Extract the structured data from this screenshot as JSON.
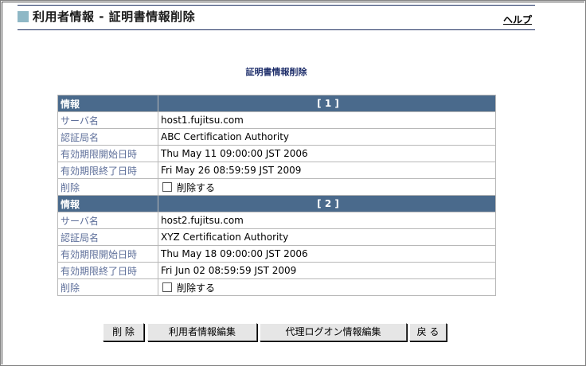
{
  "header": {
    "title": "利用者情報 - 証明書情報削除",
    "help_label": "ヘルプ"
  },
  "section_title": "証明書情報削除",
  "certificates": [
    {
      "head_label": "情報",
      "head_number": "[ 1 ]",
      "server_label": "サーバ名",
      "server_value": "host1.fujitsu.com",
      "ca_label": "認証局名",
      "ca_value": "ABC Certification Authority",
      "start_label": "有効期限開始日時",
      "start_value": "Thu May 11 09:00:00 JST 2006",
      "end_label": "有効期限終了日時",
      "end_value": "Fri May 26 08:59:59 JST 2009",
      "delete_label": "削除",
      "delete_checkbox_label": "削除する",
      "delete_checked": false
    },
    {
      "head_label": "情報",
      "head_number": "[ 2 ]",
      "server_label": "サーバ名",
      "server_value": "host2.fujitsu.com",
      "ca_label": "認証局名",
      "ca_value": "XYZ Certification Authority",
      "start_label": "有効期限開始日時",
      "start_value": "Thu May 18 09:00:00 JST 2006",
      "end_label": "有効期限終了日時",
      "end_value": "Fri Jun 02 08:59:59 JST 2009",
      "delete_label": "削除",
      "delete_checkbox_label": "削除する",
      "delete_checked": false
    }
  ],
  "buttons": {
    "delete": "削 除",
    "edit_user": "利用者情報編集",
    "edit_proxy": "代理ログオン情報編集",
    "back": "戻 る"
  },
  "colors": {
    "header_row_bg": "#4a6a8c",
    "label_text": "#5e6f9a",
    "title_marker": "#8fb8c6",
    "rule": "#1a2c5e"
  }
}
